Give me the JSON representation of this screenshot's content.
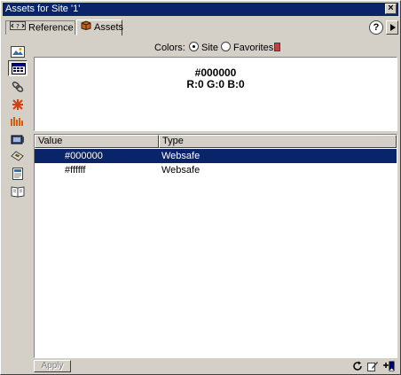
{
  "window": {
    "title": "Assets for Site '1'",
    "close_label": "×"
  },
  "tabs": [
    {
      "label": "Reference",
      "icon": "reference-icon"
    },
    {
      "label": "Assets",
      "icon": "assets-icon"
    }
  ],
  "help_label": "?",
  "sidebar": {
    "items": [
      {
        "name": "images",
        "icon": "images-icon"
      },
      {
        "name": "colors",
        "icon": "colors-icon",
        "selected": true
      },
      {
        "name": "urls",
        "icon": "urls-icon"
      },
      {
        "name": "flash",
        "icon": "flash-icon"
      },
      {
        "name": "shockwave",
        "icon": "shockwave-icon"
      },
      {
        "name": "movies",
        "icon": "movies-icon"
      },
      {
        "name": "scripts",
        "icon": "scripts-icon"
      },
      {
        "name": "templates",
        "icon": "templates-icon"
      },
      {
        "name": "library",
        "icon": "library-icon"
      }
    ]
  },
  "filter": {
    "label": "Colors:",
    "options": [
      "Site",
      "Favorites"
    ],
    "selected": "Site"
  },
  "preview": {
    "hex": "#000000",
    "rgb": "R:0 G:0 B:0"
  },
  "table": {
    "columns": [
      "Value",
      "Type"
    ],
    "rows": [
      {
        "value": "#000000",
        "type": "Websafe",
        "swatch": "#000000",
        "selected": true
      },
      {
        "value": "#ffffff",
        "type": "Websafe",
        "swatch": "#ffffff",
        "selected": false
      }
    ]
  },
  "footer": {
    "apply_label": "Apply"
  },
  "colors": {
    "titlebar": "#0a246a",
    "chrome": "#d4d0c8",
    "selection": "#0a246a"
  }
}
